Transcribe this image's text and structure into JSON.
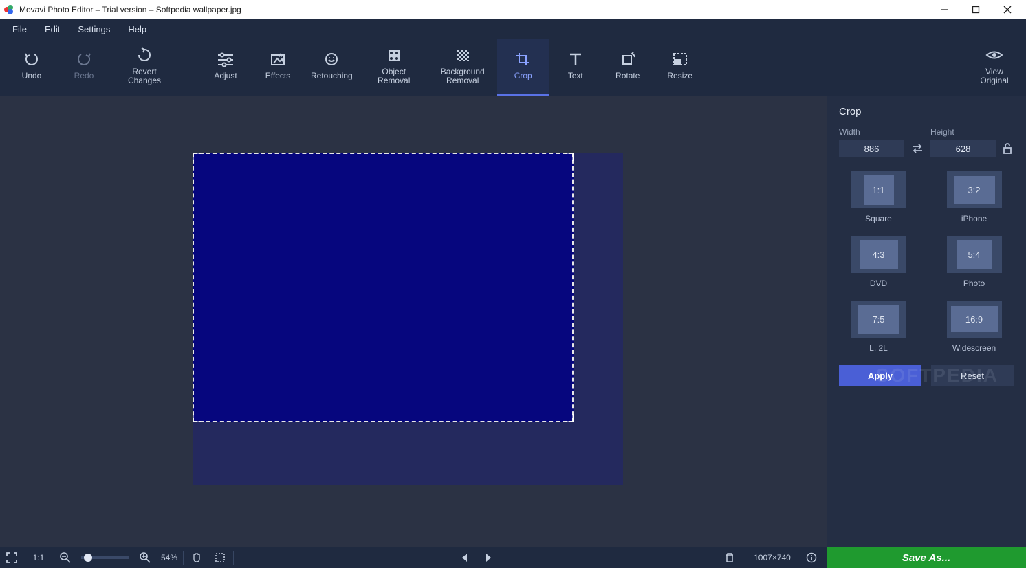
{
  "titlebar": {
    "title": "Movavi Photo Editor – Trial version – Softpedia wallpaper.jpg"
  },
  "menubar": {
    "file": "File",
    "edit": "Edit",
    "settings": "Settings",
    "help": "Help"
  },
  "toolbar": {
    "undo": "Undo",
    "redo": "Redo",
    "revert": "Revert\nChanges",
    "adjust": "Adjust",
    "effects": "Effects",
    "retouching": "Retouching",
    "object_removal": "Object\nRemoval",
    "background_removal": "Background\nRemoval",
    "crop": "Crop",
    "text": "Text",
    "rotate": "Rotate",
    "resize": "Resize",
    "view_original": "View\nOriginal"
  },
  "crop_panel": {
    "title": "Crop",
    "width_label": "Width",
    "width_value": "886",
    "height_label": "Height",
    "height_value": "628",
    "presets": {
      "square": {
        "ratio": "1:1",
        "label": "Square"
      },
      "iphone": {
        "ratio": "3:2",
        "label": "iPhone"
      },
      "dvd": {
        "ratio": "4:3",
        "label": "DVD"
      },
      "photo": {
        "ratio": "5:4",
        "label": "Photo"
      },
      "l2l": {
        "ratio": "7:5",
        "label": "L, 2L"
      },
      "widescreen": {
        "ratio": "16:9",
        "label": "Widescreen"
      }
    },
    "apply": "Apply",
    "reset": "Reset"
  },
  "bottombar": {
    "ratio": "1:1",
    "zoom_pct": "54%",
    "dimensions": "1007×740",
    "save_as": "Save As..."
  },
  "watermark": "SOFTPEDIA"
}
